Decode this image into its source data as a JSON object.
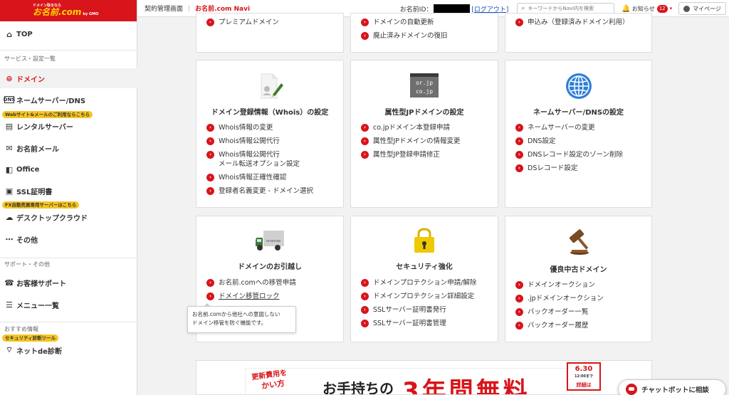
{
  "sidebar": {
    "logo_small": "ドメイン取るなら",
    "logo_main": "お名前.com",
    "logo_sub": "by GMO",
    "top": "TOP",
    "section1": "サービス・設定一覧",
    "domain": "ドメイン",
    "nameserver": "ネームサーバー/DNS",
    "pill_web": "Webサイト&メールのご利用ならこちら",
    "rental": "レンタルサーバー",
    "mail": "お名前メール",
    "office": "Office",
    "ssl": "SSL証明書",
    "pill_fx": "FX自動売買専用サーバーはこちら",
    "desktop": "デスクトップクラウド",
    "other": "その他",
    "section2": "サポート・その他",
    "support": "お客様サポート",
    "menu": "メニュー一覧",
    "section3": "おすすめ情報",
    "pill_security": "セキュリティ診断ツール",
    "netde": "ネットde診断"
  },
  "header": {
    "crumb1": "契約管理画面",
    "crumb_sep": "|",
    "crumb2": "お名前.com Navi",
    "id_label": "お名前ID：",
    "logout": "[ログアウト]",
    "search_placeholder": "キーワードからNavi内を検索",
    "notice": "お知らせ",
    "notice_count": "12",
    "mypage": "マイページ"
  },
  "cards_top": [
    {
      "links": [
        "プレミアムドメイン"
      ]
    },
    {
      "links": [
        "ドメインの自動更新",
        "廃止済みドメインの復旧"
      ]
    },
    {
      "links": [
        "申込み（登録済みドメイン利用）"
      ]
    }
  ],
  "cards_mid": [
    {
      "title": "ドメイン登録情報（Whois）の設定",
      "links": [
        "Whois情報の変更",
        "Whois情報公開代行",
        "Whois情報公開代行\nメール転送オプション設定",
        "Whois情報正確性確認",
        "登録者名義変更 - ドメイン選択"
      ]
    },
    {
      "title": "属性型JPドメインの設定",
      "icon_text1": "or.jp",
      "icon_text2": "co.jp",
      "links": [
        "co.jpドメイン本登録申請",
        "属性型JPドメインの情報変更",
        "属性型JP登録申請修正"
      ]
    },
    {
      "title": "ネームサーバー/DNSの設定",
      "links": [
        "ネームサーバーの変更",
        "DNS設定",
        "DNSレコード設定のゾーン削除",
        "DSレコード設定"
      ]
    }
  ],
  "cards_bot": [
    {
      "title": "ドメインのお引越し",
      "truck_text": "onamae",
      "links": [
        "お名前.comへの移管申請",
        "ドメイン移管ロック"
      ]
    },
    {
      "title": "セキュリティ強化",
      "links": [
        "ドメインプロテクション申請/解除",
        "ドメインプロテクション詳細設定",
        "SSLサーバー証明書発行",
        "SSLサーバー証明書管理"
      ]
    },
    {
      "title": "優良中古ドメイン",
      "links": [
        "ドメインオークション",
        ".jpドメインオークション",
        "バックオーダー一覧",
        "バックオーダー履歴"
      ]
    }
  ],
  "tooltip": "お名前.comから他社への意図しない\nドメイン移管を防ぐ機能です。",
  "banner": {
    "red1": "更新費用を",
    "red2": "かい方",
    "main": "お手持ちの",
    "big": "3年間無料",
    "date": "6.30",
    "date_small": "12:00まで",
    "detail": "詳細は"
  },
  "chatbot": "チャットボットに相談",
  "colors": {
    "brand_red": "#d8151b",
    "accent_yellow": "#f6c522",
    "link_blue": "#1a56b0"
  }
}
